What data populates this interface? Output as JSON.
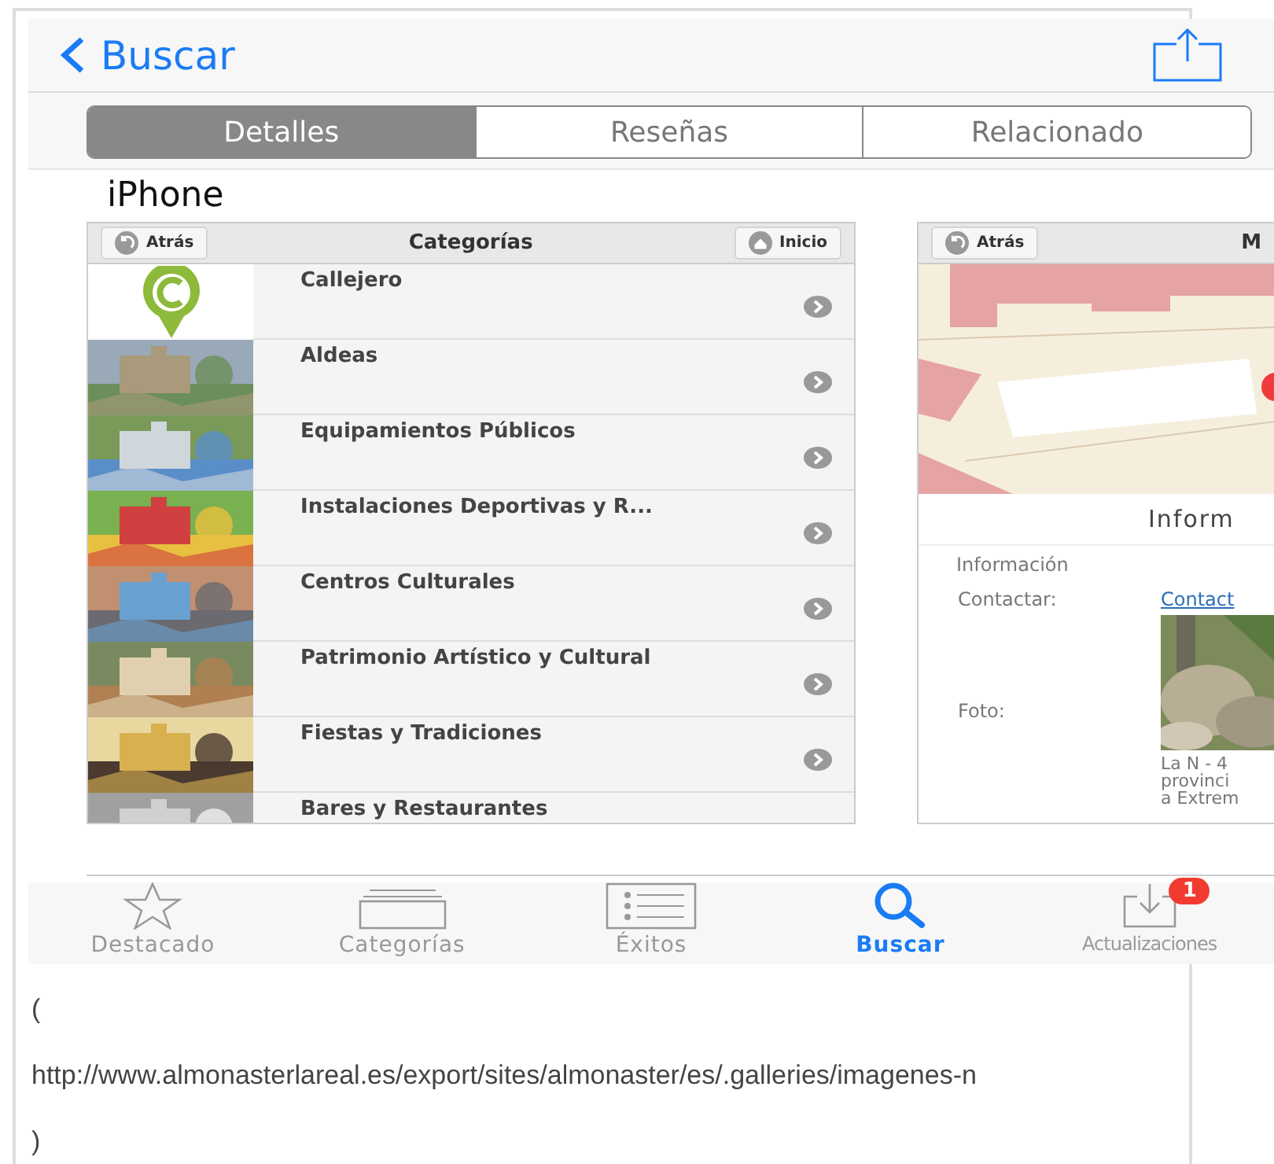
{
  "nav": {
    "back_label": "Buscar"
  },
  "segments": [
    {
      "label": "Detalles",
      "selected": true
    },
    {
      "label": "Reseñas",
      "selected": false
    },
    {
      "label": "Relacionado",
      "selected": false
    }
  ],
  "section_title": "iPhone",
  "left_screen": {
    "header": {
      "back": "Atrás",
      "title": "Categorías",
      "home": "Inicio"
    },
    "rows": [
      {
        "name": "Callejero",
        "kind": "logo"
      },
      {
        "name": "Aldeas",
        "kind": "picture"
      },
      {
        "name": "Equipamientos Públicos",
        "kind": "picture"
      },
      {
        "name": "Instalaciones Deportivas y R...",
        "kind": "picture"
      },
      {
        "name": "Centros Culturales",
        "kind": "picture"
      },
      {
        "name": "Patrimonio Artístico y Cultural",
        "kind": "picture"
      },
      {
        "name": "Fiestas y Tradiciones",
        "kind": "picture"
      },
      {
        "name": "Bares y Restaurantes",
        "kind": "picture"
      }
    ]
  },
  "right_screen": {
    "header": {
      "back": "Atrás",
      "title": "M"
    },
    "section_title": "Inform",
    "info_heading": "Información",
    "fields": [
      {
        "label": "Contactar:",
        "kind": "link",
        "value": "Contact"
      },
      {
        "label": "Foto:",
        "caption_lines": [
          "La N - 4",
          "provinci",
          "a Extrem"
        ]
      }
    ]
  },
  "tab_bar": [
    {
      "label": "Destacado",
      "kind": "featured",
      "selected": false
    },
    {
      "label": "Categorías",
      "kind": "categories",
      "selected": false
    },
    {
      "label": "Éxitos",
      "kind": "top",
      "selected": false
    },
    {
      "label": "Buscar",
      "kind": "search",
      "selected": true
    },
    {
      "label": "Actualizaciones",
      "kind": "updates",
      "selected": false,
      "badge": "1"
    }
  ],
  "footer_lines": [
    "(",
    "http://www.almonasterlareal.es/export/sites/almonaster/es/.galleries/imagenes-n",
    ")"
  ]
}
